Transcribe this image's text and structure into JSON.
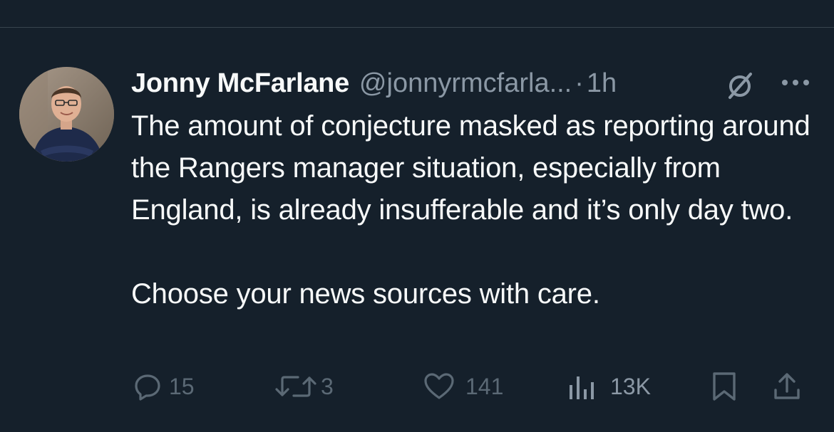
{
  "author": {
    "display_name": "Jonny McFarlane",
    "handle": "@jonnyrmcfarla...",
    "separator": "·",
    "time": "1h"
  },
  "tweet": {
    "paragraphs": [
      "The amount of conjecture masked as reporting around the Rangers manager situation, especially from England, is already insufferable and it’s only day two.",
      "Choose your news sources with care."
    ]
  },
  "actions": {
    "replies": "15",
    "retweets": "3",
    "likes": "141",
    "views": "13K"
  },
  "icons": {
    "header": [
      "slash-circle-icon",
      "more-icon"
    ],
    "actions": [
      "reply-icon",
      "retweet-icon",
      "like-icon",
      "views-icon",
      "bookmark-icon",
      "share-icon"
    ]
  },
  "colors": {
    "background": "#15202b",
    "text_primary": "#f7f9f9",
    "text_secondary": "#8b98a5",
    "action_muted": "#5b6975",
    "divider": "#38444d"
  }
}
